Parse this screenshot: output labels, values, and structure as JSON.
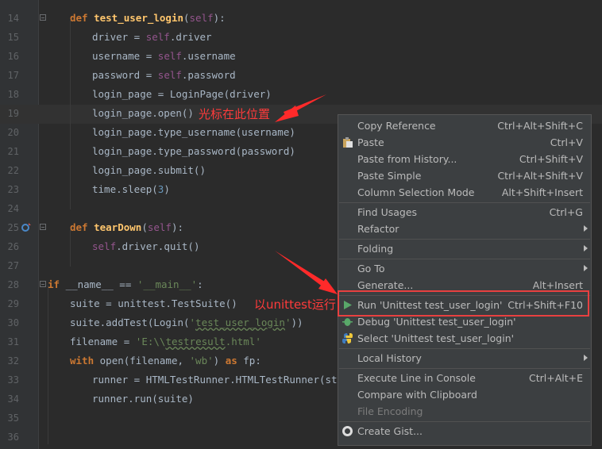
{
  "editor": {
    "lines": [
      {
        "n": "14",
        "tokens": [
          [
            "kw",
            "def "
          ],
          [
            "fn",
            "test_user_login"
          ],
          [
            "plain",
            "("
          ],
          [
            "self",
            "self"
          ],
          [
            "plain",
            "):"
          ]
        ]
      },
      {
        "n": "15",
        "tokens": [
          [
            "plain",
            "    driver = "
          ],
          [
            "self",
            "self"
          ],
          [
            "plain",
            ".driver"
          ]
        ]
      },
      {
        "n": "16",
        "tokens": [
          [
            "plain",
            "    username = "
          ],
          [
            "self",
            "self"
          ],
          [
            "plain",
            ".username"
          ]
        ]
      },
      {
        "n": "17",
        "tokens": [
          [
            "plain",
            "    password = "
          ],
          [
            "self",
            "self"
          ],
          [
            "plain",
            ".password"
          ]
        ]
      },
      {
        "n": "18",
        "tokens": [
          [
            "plain",
            "    login_page = LoginPage(driver)"
          ]
        ]
      },
      {
        "n": "19",
        "tokens": [
          [
            "plain",
            "    login_page.open()"
          ]
        ]
      },
      {
        "n": "20",
        "tokens": [
          [
            "plain",
            "    login_page.type_username(username)"
          ]
        ]
      },
      {
        "n": "21",
        "tokens": [
          [
            "plain",
            "    login_page.type_password(password)"
          ]
        ]
      },
      {
        "n": "22",
        "tokens": [
          [
            "plain",
            "    login_page.submit()"
          ]
        ]
      },
      {
        "n": "23",
        "tokens": [
          [
            "plain",
            "    time.sleep("
          ],
          [
            "num",
            "3"
          ],
          [
            "plain",
            ")"
          ]
        ]
      },
      {
        "n": "24",
        "tokens": []
      },
      {
        "n": "25",
        "tokens": [
          [
            "kw",
            "def "
          ],
          [
            "fn",
            "tearDown"
          ],
          [
            "plain",
            "("
          ],
          [
            "self",
            "self"
          ],
          [
            "plain",
            "):"
          ]
        ]
      },
      {
        "n": "26",
        "tokens": [
          [
            "self",
            "    self"
          ],
          [
            "plain",
            ".driver.quit()"
          ]
        ]
      },
      {
        "n": "27",
        "tokens": []
      },
      {
        "n": "28",
        "tokens": [
          [
            "kw",
            "if "
          ],
          [
            "plain",
            "__name__ == "
          ],
          [
            "str",
            "'__main__'"
          ],
          [
            "plain",
            ":"
          ]
        ]
      },
      {
        "n": "29",
        "tokens": [
          [
            "plain",
            "    suite = unittest.TestSuite()"
          ]
        ]
      },
      {
        "n": "30",
        "tokens": [
          [
            "plain",
            "    suite.addTest(Login("
          ],
          [
            "str",
            "'"
          ],
          [
            "strsq",
            "test_user_login"
          ],
          [
            "str",
            "'"
          ],
          [
            "plain",
            "))"
          ]
        ]
      },
      {
        "n": "31",
        "tokens": [
          [
            "plain",
            "    filename = "
          ],
          [
            "str",
            "'E:\\\\"
          ],
          [
            "strsq",
            "testresult"
          ],
          [
            "str",
            ".html'"
          ]
        ]
      },
      {
        "n": "32",
        "tokens": [
          [
            "kw",
            "    with "
          ],
          [
            "plain",
            "open(filename, "
          ],
          [
            "str",
            "'wb'"
          ],
          [
            "plain",
            ") "
          ],
          [
            "kw",
            "as "
          ],
          [
            "plain",
            "fp:"
          ]
        ]
      },
      {
        "n": "33",
        "tokens": [
          [
            "plain",
            "        runner = HTMLTestRunner.HTMLTestRunner(strea"
          ]
        ]
      },
      {
        "n": "34",
        "tokens": [
          [
            "plain",
            "        runner.run(suite)"
          ]
        ]
      },
      {
        "n": "35",
        "tokens": []
      },
      {
        "n": "36",
        "tokens": []
      }
    ]
  },
  "annotations": {
    "cursor_note": "光标在此位置",
    "run_note": "以unittest运行"
  },
  "menu": {
    "items": [
      {
        "label": "Copy Reference",
        "shortcut": "Ctrl+Alt+Shift+C"
      },
      {
        "label": "Paste",
        "shortcut": "Ctrl+V",
        "icon": "clipboard-icon"
      },
      {
        "label": "Paste from History...",
        "shortcut": "Ctrl+Shift+V"
      },
      {
        "label": "Paste Simple",
        "shortcut": "Ctrl+Alt+Shift+V"
      },
      {
        "label": "Column Selection Mode",
        "shortcut": "Alt+Shift+Insert"
      },
      {
        "sep": true
      },
      {
        "label": "Find Usages",
        "shortcut": "Ctrl+G"
      },
      {
        "label": "Refactor",
        "submenu": true
      },
      {
        "sep": true
      },
      {
        "label": "Folding",
        "submenu": true
      },
      {
        "sep": true
      },
      {
        "label": "Go To",
        "submenu": true
      },
      {
        "label": "Generate...",
        "shortcut": "Alt+Insert"
      },
      {
        "sep": true
      },
      {
        "label": "Run 'Unittest test_user_login'",
        "shortcut": "Ctrl+Shift+F10",
        "icon": "run-icon"
      },
      {
        "label": "Debug 'Unittest test_user_login'",
        "icon": "debug-icon"
      },
      {
        "label": "Select 'Unittest test_user_login'",
        "icon": "python-icon"
      },
      {
        "sep": true
      },
      {
        "label": "Local History",
        "submenu": true
      },
      {
        "sep": true
      },
      {
        "label": "Execute Line in Console",
        "shortcut": "Ctrl+Alt+E"
      },
      {
        "label": "Compare with Clipboard"
      },
      {
        "label": "File Encoding",
        "disabled": true
      },
      {
        "sep": true
      },
      {
        "label": "Create Gist...",
        "icon": "github-icon"
      }
    ]
  },
  "colors": {
    "background": "#2b2b2b",
    "menu_background": "#3c3f41",
    "keyword": "#cc7832",
    "function": "#ffc66d",
    "self": "#94558d",
    "string": "#6a8759",
    "annotation": "#ff3b3b"
  }
}
